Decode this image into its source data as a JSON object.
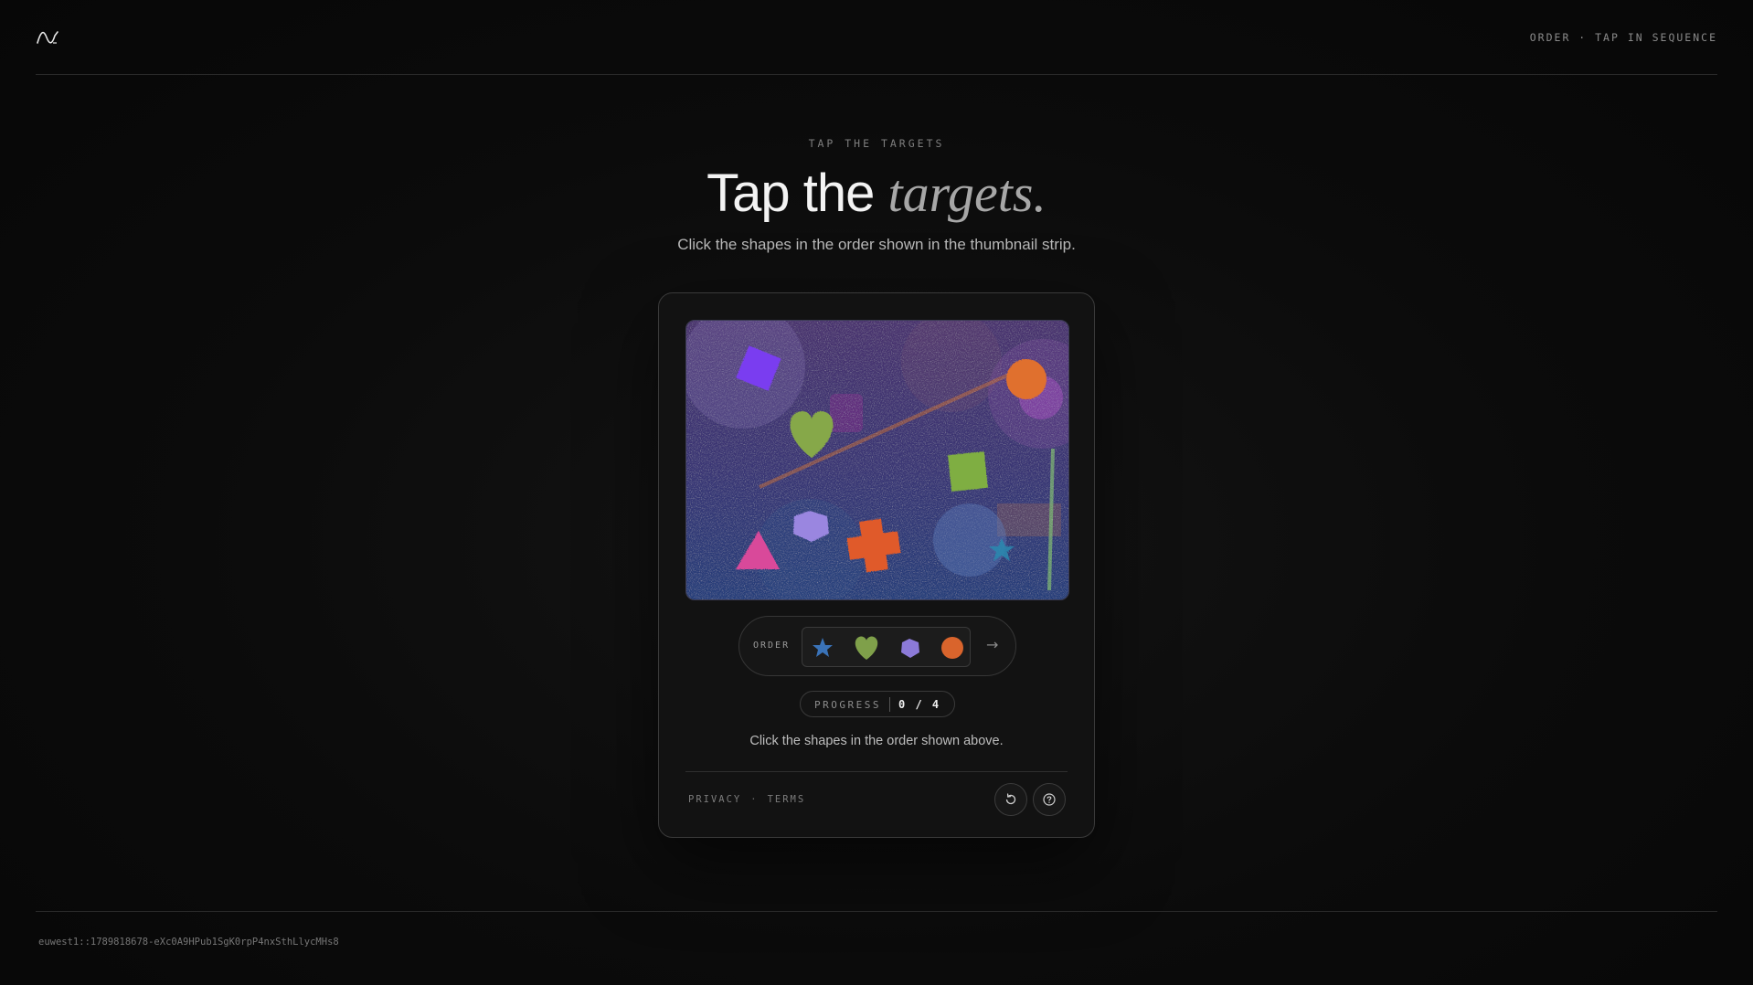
{
  "header": {
    "logo_icon": "wave-logo-icon",
    "right_label": "ORDER · TAP IN SEQUENCE"
  },
  "hero": {
    "eyebrow": "TAP THE TARGETS",
    "title_plain": "Tap the ",
    "title_emphasis": "targets.",
    "subtitle": "Click the shapes in the order shown in the thumbnail strip."
  },
  "challenge": {
    "canvas_shapes": [
      "diamond",
      "heart",
      "square",
      "triangle",
      "pentagon",
      "cross",
      "star",
      "circle"
    ],
    "order": {
      "label": "ORDER",
      "sequence": [
        "star",
        "heart",
        "pentagon",
        "circle"
      ],
      "sequence_colors": [
        "#3a73b8",
        "#7fa04a",
        "#8c7ad8",
        "#d9642c"
      ],
      "next_icon": "arrow-right-icon"
    },
    "progress": {
      "label": "PROGRESS",
      "value": "0 / 4",
      "completed": 0,
      "total": 4
    },
    "hint": "Click the shapes in the order shown above."
  },
  "card_footer": {
    "privacy_label": "PRIVACY",
    "separator": "·",
    "terms_label": "TERMS",
    "refresh_icon": "refresh-icon",
    "help_icon": "help-icon"
  },
  "footer": {
    "session_id": "euwest1::1789818678-eXc0A9HPub1SgK0rpP4nxSthLlycMHs8"
  },
  "colors": {
    "background": "#0b0b0b",
    "card": "#121212",
    "canvas_top": "#4a3570",
    "canvas_bottom": "#2a3d78",
    "accent_text": "#f3f3f3"
  }
}
